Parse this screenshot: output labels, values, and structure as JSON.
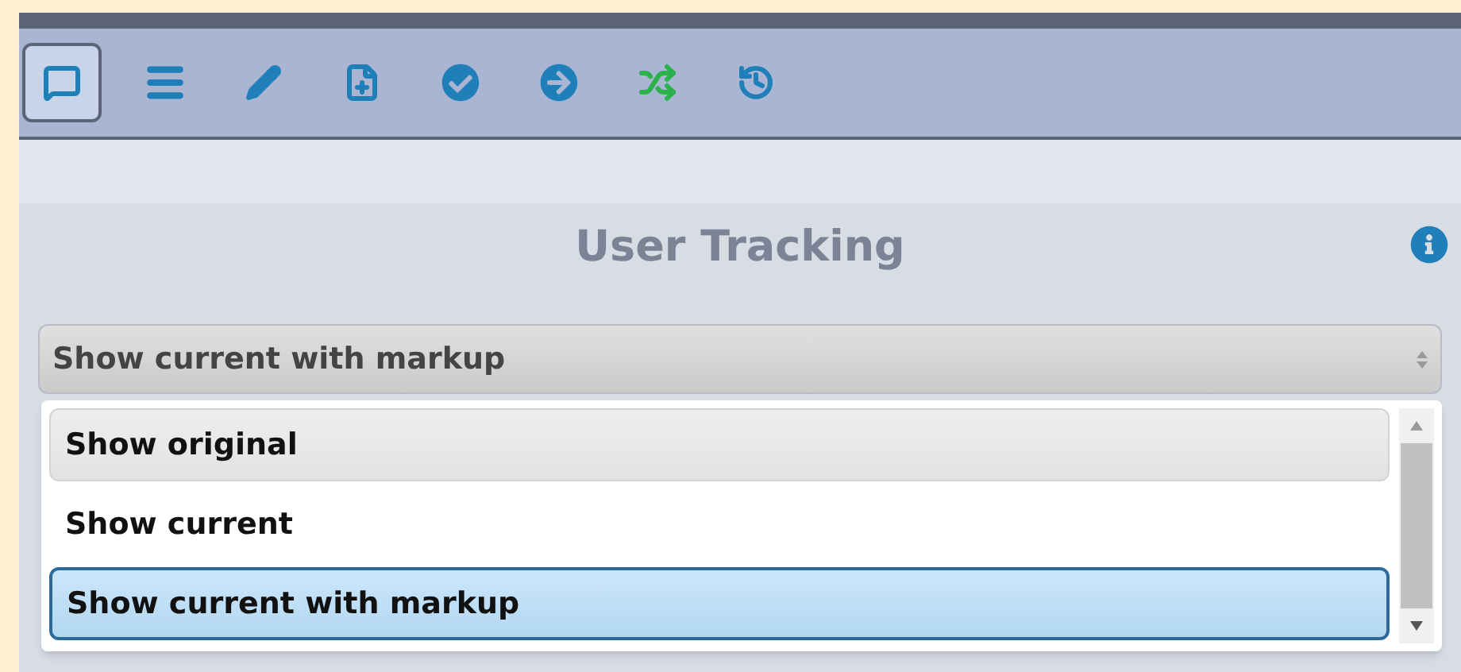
{
  "toolbar": [
    {
      "kind": "comment",
      "selected": true
    },
    {
      "kind": "list",
      "selected": false
    },
    {
      "kind": "pencil",
      "selected": false
    },
    {
      "kind": "add-page",
      "selected": false
    },
    {
      "kind": "check",
      "selected": false
    },
    {
      "kind": "arrow",
      "selected": false
    },
    {
      "kind": "shuffle",
      "selected": false
    },
    {
      "kind": "history",
      "selected": false
    }
  ],
  "panel": {
    "title": "User Tracking"
  },
  "select": {
    "value": "Show current with markup",
    "expanded": true
  },
  "options": [
    {
      "label": "Show original",
      "selected": false,
      "hovered": true
    },
    {
      "label": "Show current",
      "selected": false,
      "hovered": false
    },
    {
      "label": "Show current with markup",
      "selected": true,
      "hovered": false
    }
  ]
}
